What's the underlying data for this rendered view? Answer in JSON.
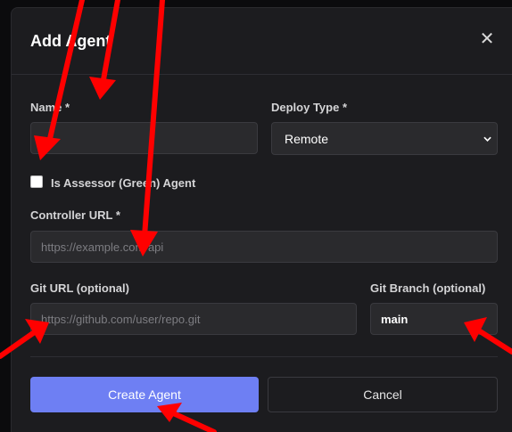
{
  "dialog": {
    "title": "Add Agent",
    "close_glyph": "✕"
  },
  "form": {
    "name": {
      "label": "Name *",
      "value": ""
    },
    "deploy_type": {
      "label": "Deploy Type *",
      "selected": "Remote"
    },
    "assessor": {
      "label": "Is Assessor (Green) Agent",
      "checked": false
    },
    "controller_url": {
      "label": "Controller URL *",
      "placeholder": "https://example.com/api"
    },
    "git_url": {
      "label": "Git URL (optional)",
      "placeholder": "https://github.com/user/repo.git"
    },
    "git_branch": {
      "label": "Git Branch (optional)",
      "value": "main"
    }
  },
  "actions": {
    "create_label": "Create Agent",
    "cancel_label": "Cancel"
  },
  "colors": {
    "accent": "#6e7ff3",
    "annotation_arrow": "#ff0000"
  },
  "icons": [
    "close-icon",
    "chevron-down-icon",
    "annotation-arrow-icon"
  ]
}
